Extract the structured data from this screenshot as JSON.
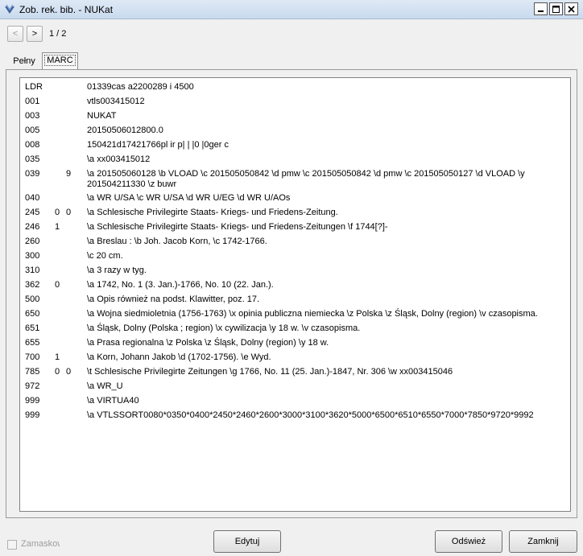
{
  "window": {
    "title": "Zob. rek. bib. - NUKat",
    "minimize": "_",
    "close": "X"
  },
  "nav": {
    "prev": "<",
    "next": ">",
    "page": "1 / 2"
  },
  "tabs": [
    {
      "label": "Pełny",
      "active": false
    },
    {
      "label": "MARC",
      "active": true
    }
  ],
  "record": [
    {
      "tag": "LDR",
      "ind1": "",
      "ind2": "",
      "value": "01339cas a2200289 i 4500"
    },
    {
      "tag": "001",
      "ind1": "",
      "ind2": "",
      "value": "vtls003415012"
    },
    {
      "tag": "003",
      "ind1": "",
      "ind2": "",
      "value": "NUKAT"
    },
    {
      "tag": "005",
      "ind1": "",
      "ind2": "",
      "value": "20150506012800.0"
    },
    {
      "tag": "008",
      "ind1": "",
      "ind2": "",
      "value": "150421d17421766pl ir p|  |  |0   |0ger c"
    },
    {
      "tag": "035",
      "ind1": "",
      "ind2": "",
      "value": "\\a xx003415012"
    },
    {
      "tag": "039",
      "ind1": "",
      "ind2": "9",
      "value": "\\a 201505060128 \\b VLOAD \\c 201505050842 \\d pmw \\c 201505050842 \\d pmw \\c 201505050127 \\d VLOAD \\y 201504211330 \\z buwr"
    },
    {
      "tag": "040",
      "ind1": "",
      "ind2": "",
      "value": "\\a WR U/SA \\c WR U/SA \\d WR U/EG \\d WR U/AOs"
    },
    {
      "tag": "245",
      "ind1": "0",
      "ind2": "0",
      "value": "\\a Schlesische Privilegirte Staats- Kriegs- und Friedens-Zeitung."
    },
    {
      "tag": "246",
      "ind1": "1",
      "ind2": "",
      "value": "\\a Schlesische Privilegirte Staats- Kriegs- und Friedens-Zeitungen \\f 1744[?]-"
    },
    {
      "tag": "260",
      "ind1": "",
      "ind2": "",
      "value": "\\a Breslau : \\b Joh. Jacob Korn, \\c 1742-1766."
    },
    {
      "tag": "300",
      "ind1": "",
      "ind2": "",
      "value": "\\c 20 cm."
    },
    {
      "tag": "310",
      "ind1": "",
      "ind2": "",
      "value": "\\a 3 razy w tyg."
    },
    {
      "tag": "362",
      "ind1": "0",
      "ind2": "",
      "value": "\\a 1742, No. 1 (3. Jan.)-1766, No. 10 (22. Jan.)."
    },
    {
      "tag": "500",
      "ind1": "",
      "ind2": "",
      "value": "\\a Opis również na podst. Klawitter, poz. 17."
    },
    {
      "tag": "650",
      "ind1": "",
      "ind2": "",
      "value": "\\a Wojna siedmioletnia (1756-1763) \\x opinia publiczna niemiecka \\z Polska \\z Śląsk, Dolny (region) \\v czasopisma."
    },
    {
      "tag": "651",
      "ind1": "",
      "ind2": "",
      "value": "\\a Śląsk, Dolny (Polska ; region) \\x cywilizacja \\y 18 w. \\v czasopisma."
    },
    {
      "tag": "655",
      "ind1": "",
      "ind2": "",
      "value": "\\a Prasa regionalna \\z Polska \\z Śląsk, Dolny (region) \\y 18 w."
    },
    {
      "tag": "700",
      "ind1": "1",
      "ind2": "",
      "value": "\\a Korn, Johann Jakob \\d (1702-1756). \\e Wyd."
    },
    {
      "tag": "785",
      "ind1": "0",
      "ind2": "0",
      "value": "\\t Schlesische Privilegirte Zeitungen \\g 1766, No. 11 (25. Jan.)-1847, Nr. 306 \\w xx003415046"
    },
    {
      "tag": "972",
      "ind1": "",
      "ind2": "",
      "value": "\\a WR_U"
    },
    {
      "tag": "999",
      "ind1": "",
      "ind2": "",
      "value": "\\a VIRTUA40"
    },
    {
      "tag": "999",
      "ind1": "",
      "ind2": "",
      "value": "\\a VTLSSORT0080*0350*0400*2450*2460*2600*3000*3100*3620*5000*6500*6510*6550*7000*7850*9720*9992"
    }
  ],
  "footer": {
    "mask_label": "Zamaskow",
    "mask_checked": false,
    "edit": "Edytuj",
    "refresh": "Odśwież",
    "close": "Zamknij"
  }
}
